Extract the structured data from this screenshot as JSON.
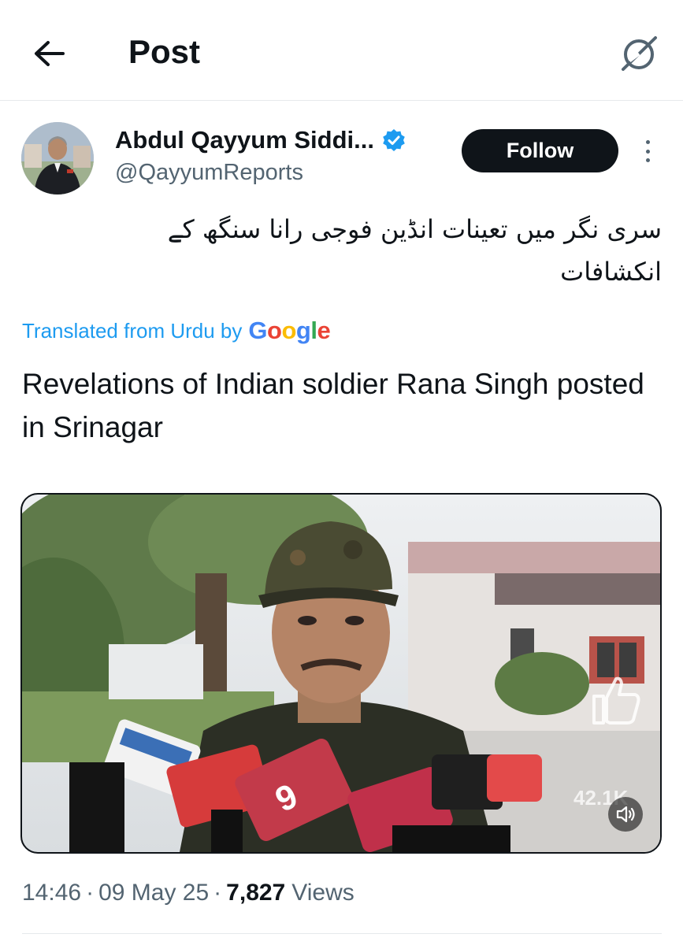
{
  "header": {
    "title": "Post",
    "back_icon": "arrow-left-icon",
    "grok_icon": "grok-icon"
  },
  "author": {
    "display_name": "Abdul Qayyum Siddi...",
    "handle": "@QayyumReports",
    "verified": true,
    "verified_color": "#1d9bf0",
    "follow_label": "Follow"
  },
  "post": {
    "urdu_text": "سری نگر میں تعینات انڈین فوجی رانا سنگھ کے انکشافات",
    "translated_prefix": "Translated from Urdu by",
    "translator": "Google",
    "translation": "Revelations of Indian soldier Rana Singh posted in Srinagar"
  },
  "media": {
    "type": "video",
    "overlay_count": "42.1K",
    "mute_icon": "speaker-icon"
  },
  "meta": {
    "time": "14:46",
    "date": "09 May 25",
    "views_count": "7,827",
    "views_label": "Views"
  },
  "colors": {
    "accent": "#1d9bf0",
    "text": "#0f1419",
    "secondary": "#536471"
  }
}
